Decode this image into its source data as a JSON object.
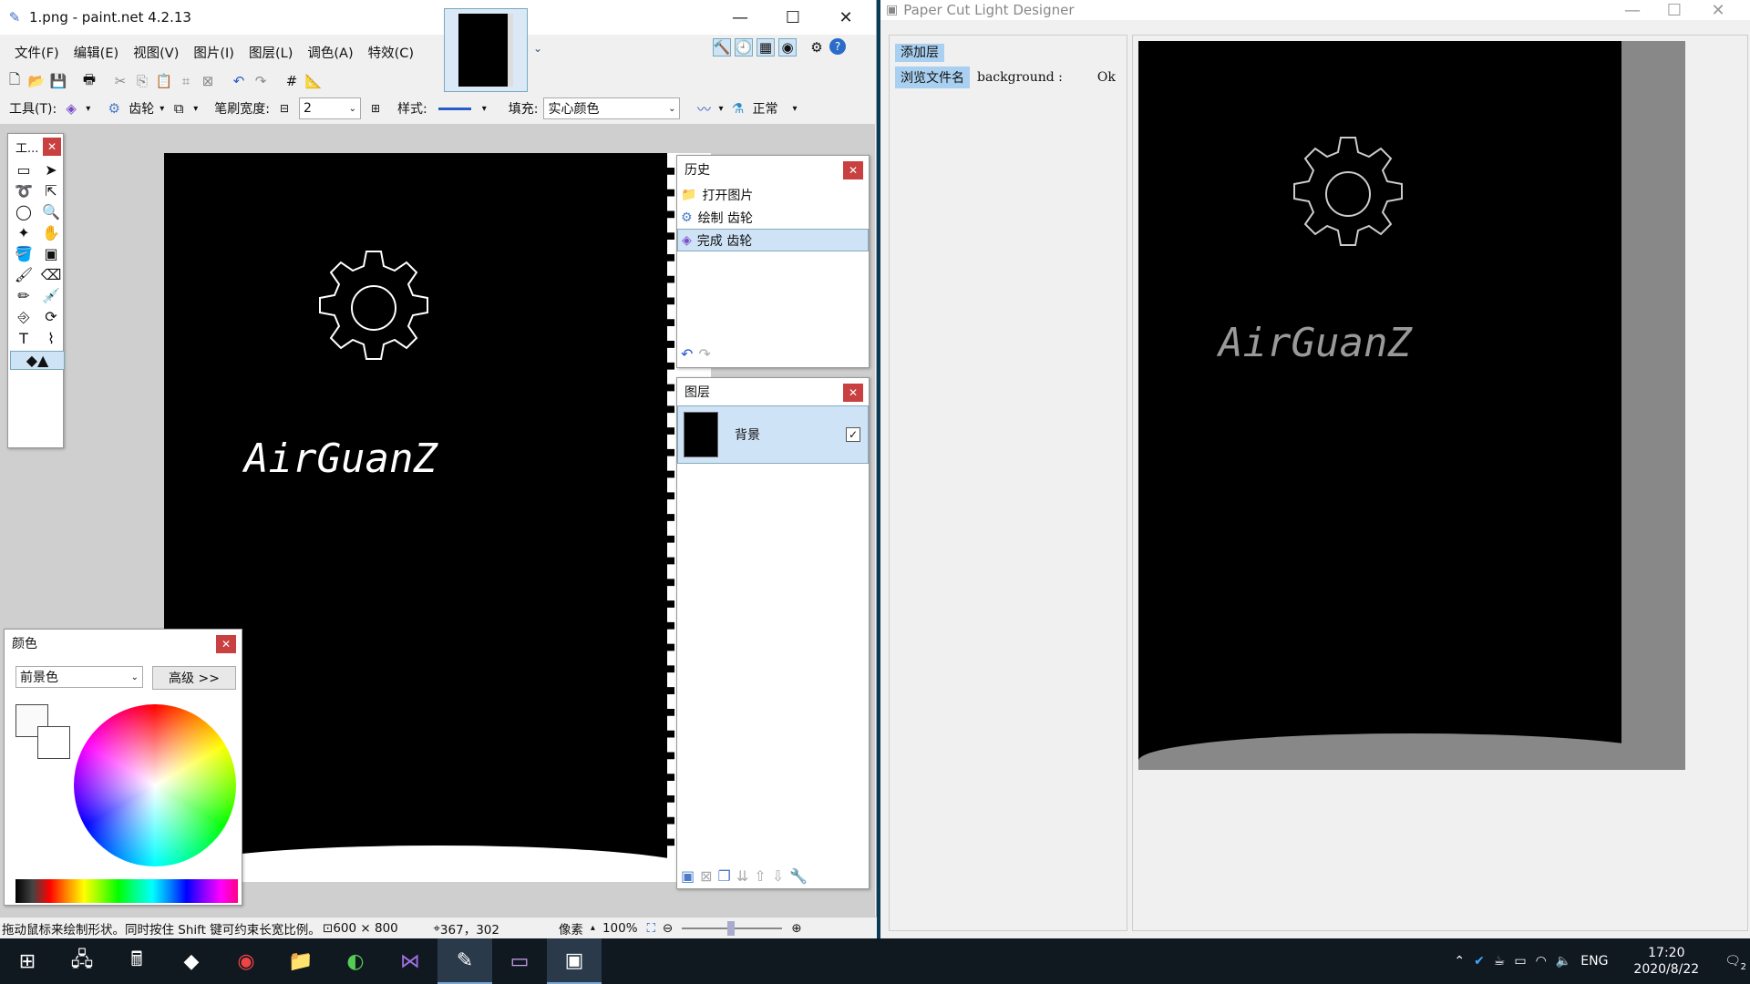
{
  "pdn": {
    "title": "1.png - paint.net 4.2.13",
    "menu": [
      "文件(F)",
      "编辑(E)",
      "视图(V)",
      "图片(I)",
      "图层(L)",
      "调色(A)",
      "特效(C)"
    ],
    "toolbar": {
      "tool_label": "工具(T):",
      "shape_name": "齿轮",
      "brush_width_label": "笔刷宽度:",
      "brush_width_value": "2",
      "style_label": "样式:",
      "fill_label": "填充:",
      "fill_value": "实心颜色",
      "blend_value": "正常"
    },
    "tools_panel_title": "工...",
    "canvas_text": "AirGuanZ",
    "history": {
      "title": "历史",
      "items": [
        "打开图片",
        "绘制 齿轮",
        "完成 齿轮"
      ]
    },
    "layers": {
      "title": "图层",
      "items": [
        "背景"
      ]
    },
    "colors": {
      "title": "颜色",
      "mode": "前景色",
      "advanced": "高级 >>"
    },
    "status": {
      "hint": "拖动鼠标来绘制形状。同时按住 Shift 键可约束长宽比例。",
      "size": "600 × 800",
      "pos": "367，302",
      "unit": "像素",
      "zoom": "100%"
    }
  },
  "pcl": {
    "title": "Paper Cut Light Designer",
    "add_layer": "添加层",
    "browse": "浏览文件名",
    "layer_name": "background :",
    "ok": "Ok",
    "preview_text": "AirGuanZ"
  },
  "taskbar": {
    "time": "17:20",
    "date": "2020/8/22",
    "lang": "ENG",
    "notif": "2"
  }
}
